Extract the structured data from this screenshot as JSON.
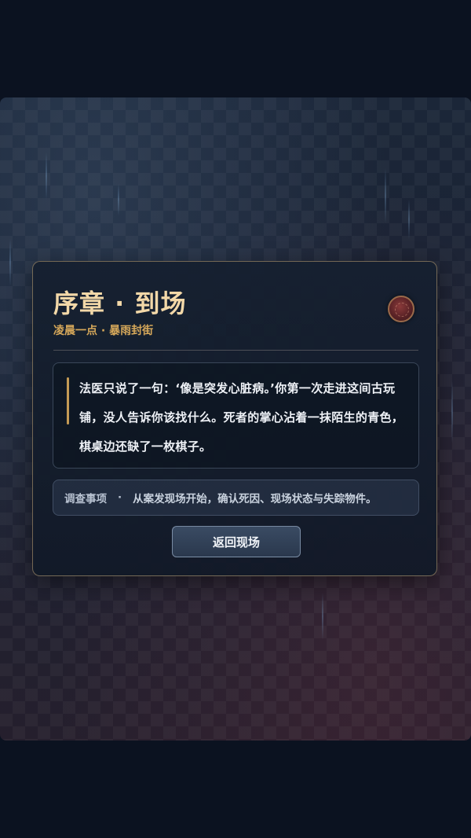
{
  "chapter": {
    "title": "序章 · 到场",
    "subtitle": "凌晨一点 · 暴雨封街"
  },
  "story": {
    "text": "法医只说了一句：‘像是突发心脏病。’你第一次走进这间古玩铺，没人告诉你该找什么。死者的掌心沾着一抹陌生的青色，棋桌边还缺了一枚棋子。"
  },
  "objective": {
    "label": "调查事项",
    "separator": "·",
    "text": "从案发现场开始，确认死因、现场状态与失踪物件。"
  },
  "actions": {
    "return_label": "返回现场"
  },
  "icons": {
    "seal": "wax-seal-icon"
  },
  "colors": {
    "title": "#f3d8a8",
    "subtitle": "#d6a85a",
    "accent_bar": "#c49a55",
    "panel_border": "#c4a878"
  }
}
